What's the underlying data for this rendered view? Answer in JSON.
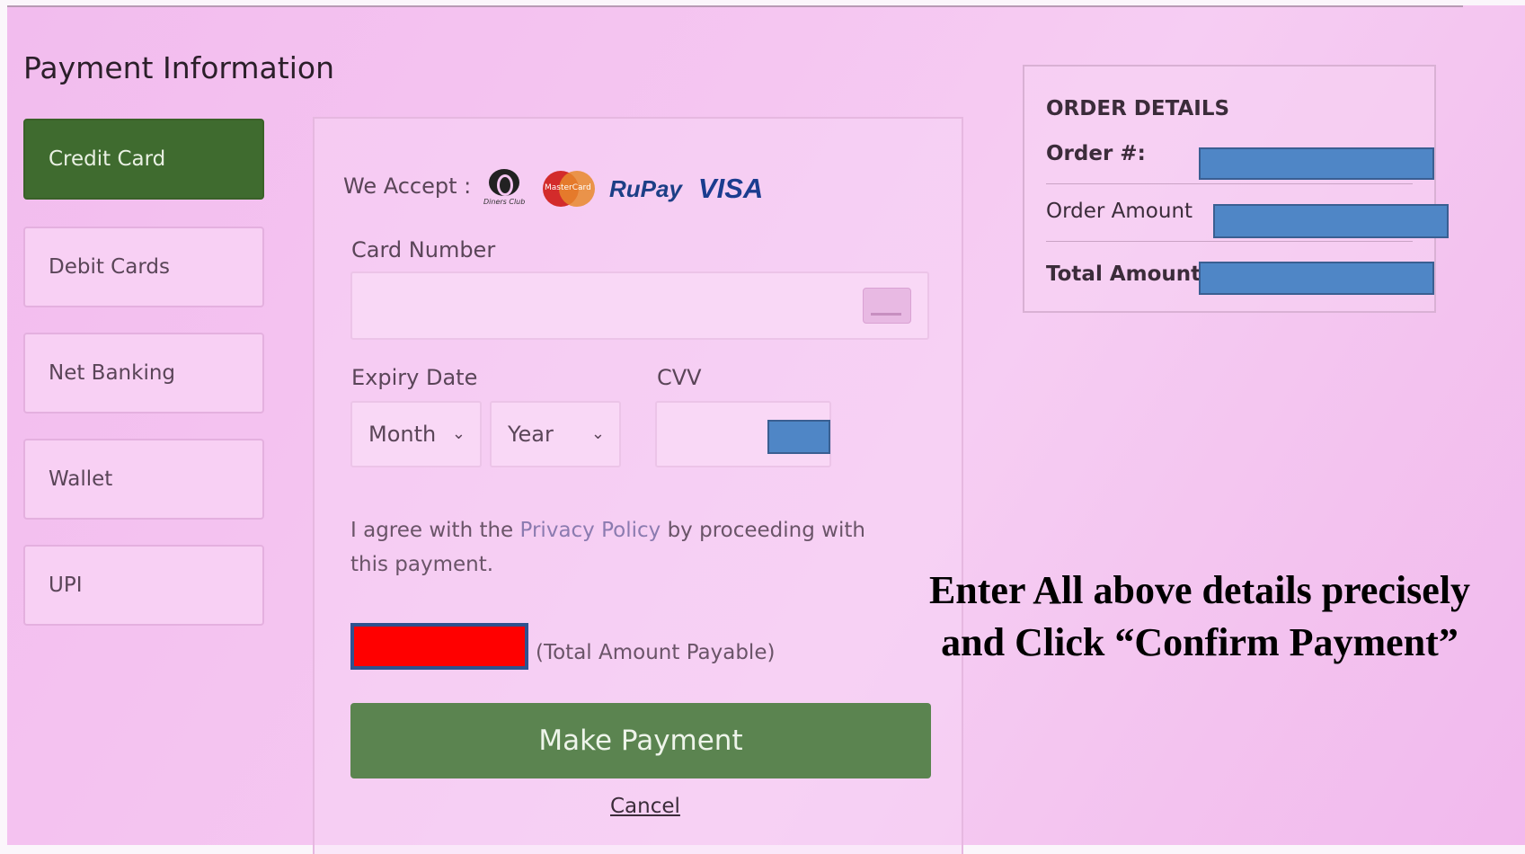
{
  "page_title": "Payment Information",
  "tabs": [
    {
      "label": "Credit Card",
      "active": true
    },
    {
      "label": "Debit Cards",
      "active": false
    },
    {
      "label": "Net Banking",
      "active": false
    },
    {
      "label": "Wallet",
      "active": false
    },
    {
      "label": "UPI",
      "active": false
    }
  ],
  "form": {
    "we_accept_label": "We Accept :",
    "card_brands": {
      "diners_text": "Diners Club",
      "mastercard_text": "MasterCard",
      "rupay": "RuPay",
      "visa": "VISA"
    },
    "card_number_label": "Card Number",
    "card_number_value": "",
    "expiry_label": "Expiry Date",
    "month_selected": "Month",
    "year_selected": "Year",
    "cvv_label": "CVV",
    "cvv_value": "",
    "agree_prefix": "I agree with the ",
    "agree_link": "Privacy Policy",
    "agree_suffix": " by proceeding with this payment.",
    "payable_label": "(Total Amount Payable)",
    "pay_button": "Make Payment",
    "cancel_link": "Cancel"
  },
  "order_details": {
    "heading": "ORDER DETAILS",
    "order_no_label": "Order #:",
    "order_amount_label": "Order  Amount",
    "total_amount_label": "Total Amount"
  },
  "overlay_note": {
    "line1": "Enter All above details precisely",
    "line2": "and Click “Confirm Payment”"
  },
  "colors": {
    "active_tab": "#3f6b2f",
    "pay_button": "#5b8450",
    "redaction_blue": "#4f86c6",
    "redaction_red": "#ff0000",
    "background": "#f5c6f1"
  }
}
